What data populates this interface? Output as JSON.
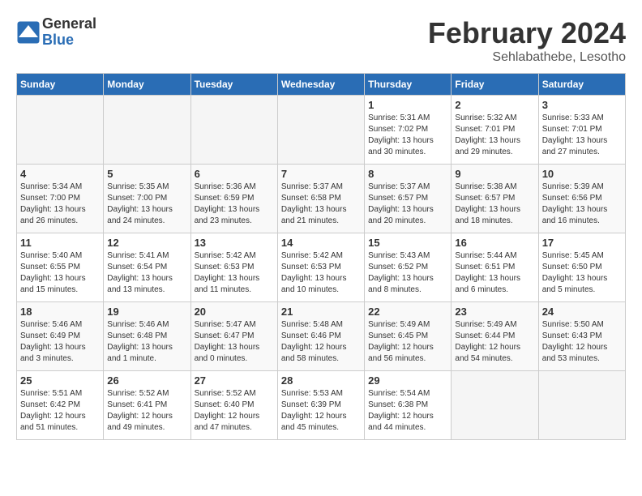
{
  "header": {
    "logo_general": "General",
    "logo_blue": "Blue",
    "month_title": "February 2024",
    "subtitle": "Sehlabathebe, Lesotho"
  },
  "days_of_week": [
    "Sunday",
    "Monday",
    "Tuesday",
    "Wednesday",
    "Thursday",
    "Friday",
    "Saturday"
  ],
  "weeks": [
    [
      {
        "day": "",
        "info": ""
      },
      {
        "day": "",
        "info": ""
      },
      {
        "day": "",
        "info": ""
      },
      {
        "day": "",
        "info": ""
      },
      {
        "day": "1",
        "info": "Sunrise: 5:31 AM\nSunset: 7:02 PM\nDaylight: 13 hours\nand 30 minutes."
      },
      {
        "day": "2",
        "info": "Sunrise: 5:32 AM\nSunset: 7:01 PM\nDaylight: 13 hours\nand 29 minutes."
      },
      {
        "day": "3",
        "info": "Sunrise: 5:33 AM\nSunset: 7:01 PM\nDaylight: 13 hours\nand 27 minutes."
      }
    ],
    [
      {
        "day": "4",
        "info": "Sunrise: 5:34 AM\nSunset: 7:00 PM\nDaylight: 13 hours\nand 26 minutes."
      },
      {
        "day": "5",
        "info": "Sunrise: 5:35 AM\nSunset: 7:00 PM\nDaylight: 13 hours\nand 24 minutes."
      },
      {
        "day": "6",
        "info": "Sunrise: 5:36 AM\nSunset: 6:59 PM\nDaylight: 13 hours\nand 23 minutes."
      },
      {
        "day": "7",
        "info": "Sunrise: 5:37 AM\nSunset: 6:58 PM\nDaylight: 13 hours\nand 21 minutes."
      },
      {
        "day": "8",
        "info": "Sunrise: 5:37 AM\nSunset: 6:57 PM\nDaylight: 13 hours\nand 20 minutes."
      },
      {
        "day": "9",
        "info": "Sunrise: 5:38 AM\nSunset: 6:57 PM\nDaylight: 13 hours\nand 18 minutes."
      },
      {
        "day": "10",
        "info": "Sunrise: 5:39 AM\nSunset: 6:56 PM\nDaylight: 13 hours\nand 16 minutes."
      }
    ],
    [
      {
        "day": "11",
        "info": "Sunrise: 5:40 AM\nSunset: 6:55 PM\nDaylight: 13 hours\nand 15 minutes."
      },
      {
        "day": "12",
        "info": "Sunrise: 5:41 AM\nSunset: 6:54 PM\nDaylight: 13 hours\nand 13 minutes."
      },
      {
        "day": "13",
        "info": "Sunrise: 5:42 AM\nSunset: 6:53 PM\nDaylight: 13 hours\nand 11 minutes."
      },
      {
        "day": "14",
        "info": "Sunrise: 5:42 AM\nSunset: 6:53 PM\nDaylight: 13 hours\nand 10 minutes."
      },
      {
        "day": "15",
        "info": "Sunrise: 5:43 AM\nSunset: 6:52 PM\nDaylight: 13 hours\nand 8 minutes."
      },
      {
        "day": "16",
        "info": "Sunrise: 5:44 AM\nSunset: 6:51 PM\nDaylight: 13 hours\nand 6 minutes."
      },
      {
        "day": "17",
        "info": "Sunrise: 5:45 AM\nSunset: 6:50 PM\nDaylight: 13 hours\nand 5 minutes."
      }
    ],
    [
      {
        "day": "18",
        "info": "Sunrise: 5:46 AM\nSunset: 6:49 PM\nDaylight: 13 hours\nand 3 minutes."
      },
      {
        "day": "19",
        "info": "Sunrise: 5:46 AM\nSunset: 6:48 PM\nDaylight: 13 hours\nand 1 minute."
      },
      {
        "day": "20",
        "info": "Sunrise: 5:47 AM\nSunset: 6:47 PM\nDaylight: 13 hours\nand 0 minutes."
      },
      {
        "day": "21",
        "info": "Sunrise: 5:48 AM\nSunset: 6:46 PM\nDaylight: 12 hours\nand 58 minutes."
      },
      {
        "day": "22",
        "info": "Sunrise: 5:49 AM\nSunset: 6:45 PM\nDaylight: 12 hours\nand 56 minutes."
      },
      {
        "day": "23",
        "info": "Sunrise: 5:49 AM\nSunset: 6:44 PM\nDaylight: 12 hours\nand 54 minutes."
      },
      {
        "day": "24",
        "info": "Sunrise: 5:50 AM\nSunset: 6:43 PM\nDaylight: 12 hours\nand 53 minutes."
      }
    ],
    [
      {
        "day": "25",
        "info": "Sunrise: 5:51 AM\nSunset: 6:42 PM\nDaylight: 12 hours\nand 51 minutes."
      },
      {
        "day": "26",
        "info": "Sunrise: 5:52 AM\nSunset: 6:41 PM\nDaylight: 12 hours\nand 49 minutes."
      },
      {
        "day": "27",
        "info": "Sunrise: 5:52 AM\nSunset: 6:40 PM\nDaylight: 12 hours\nand 47 minutes."
      },
      {
        "day": "28",
        "info": "Sunrise: 5:53 AM\nSunset: 6:39 PM\nDaylight: 12 hours\nand 45 minutes."
      },
      {
        "day": "29",
        "info": "Sunrise: 5:54 AM\nSunset: 6:38 PM\nDaylight: 12 hours\nand 44 minutes."
      },
      {
        "day": "",
        "info": ""
      },
      {
        "day": "",
        "info": ""
      }
    ]
  ]
}
